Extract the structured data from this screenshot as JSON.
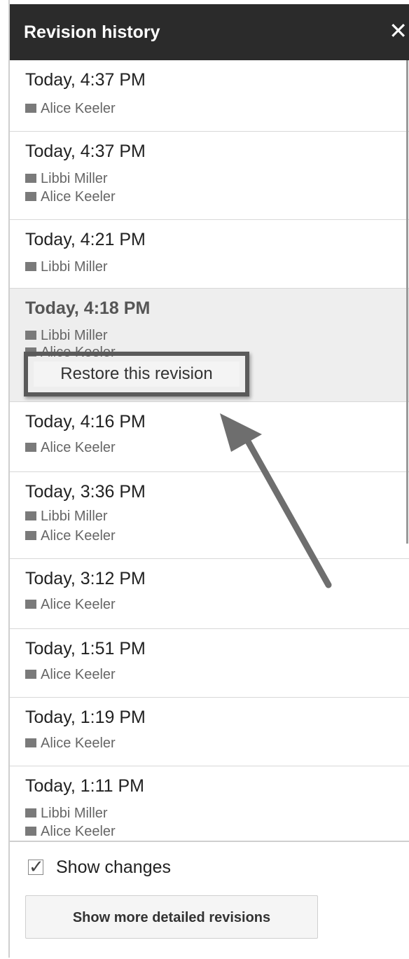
{
  "header": {
    "title": "Revision history",
    "close_icon": "close-icon"
  },
  "revisions": [
    {
      "time": "Today, 4:37 PM",
      "authors": [
        "Alice Keeler"
      ]
    },
    {
      "time": "Today, 4:37 PM",
      "authors": [
        "Libbi Miller",
        "Alice Keeler"
      ]
    },
    {
      "time": "Today, 4:21 PM",
      "authors": [
        "Libbi Miller"
      ]
    },
    {
      "time": "Today, 4:18 PM",
      "authors": [
        "Libbi Miller",
        "Alice Keeler"
      ],
      "selected": true
    },
    {
      "time": "Today, 4:16 PM",
      "authors": [
        "Alice Keeler"
      ]
    },
    {
      "time": "Today, 3:36 PM",
      "authors": [
        "Libbi Miller",
        "Alice Keeler"
      ]
    },
    {
      "time": "Today, 3:12 PM",
      "authors": [
        "Alice Keeler"
      ]
    },
    {
      "time": "Today, 1:51 PM",
      "authors": [
        "Alice Keeler"
      ]
    },
    {
      "time": "Today, 1:19 PM",
      "authors": [
        "Alice Keeler"
      ]
    },
    {
      "time": "Today, 1:11 PM",
      "authors": [
        "Libbi Miller",
        "Alice Keeler"
      ]
    }
  ],
  "restore_label": "Restore this revision",
  "footer": {
    "show_changes_label": "Show changes",
    "show_changes_checked": true,
    "detailed_button_label": "Show more detailed revisions"
  },
  "colors": {
    "header_bg": "#2b2b2b",
    "selected_bg": "#eeeeee",
    "author_swatch": "#7a7a7a",
    "arrow": "#6e6e6e"
  }
}
